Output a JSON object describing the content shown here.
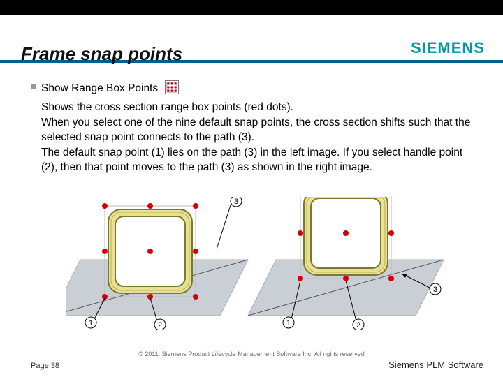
{
  "header": {
    "title": "Frame snap points",
    "logo": "SIEMENS"
  },
  "content": {
    "bullet_heading": "Show Range Box Points",
    "para1": "Shows the cross section range box points (red dots).",
    "para2": "When you select one of the nine default snap points, the cross section shifts such that the selected snap point connects to the path (3).",
    "para3": "The default snap point (1) lies on the path (3) in the left image. If you select handle point (2), then that point moves to the path (3) as shown in the right image."
  },
  "figure": {
    "labels": {
      "one": "1",
      "two": "2",
      "three": "3"
    }
  },
  "footer": {
    "copyright": "© 2011. Siemens Product Lifecycle Management Software Inc. All rights reserved",
    "page": "Page 38",
    "brand": "Siemens PLM Software"
  },
  "colors": {
    "accent_bar": "#005f8c",
    "siemens_teal": "#009aa6",
    "red_dot": "#d40000",
    "tube_fill": "#e8e092",
    "tube_stroke": "#7a7a2a",
    "surface": "#c9cfd4"
  }
}
